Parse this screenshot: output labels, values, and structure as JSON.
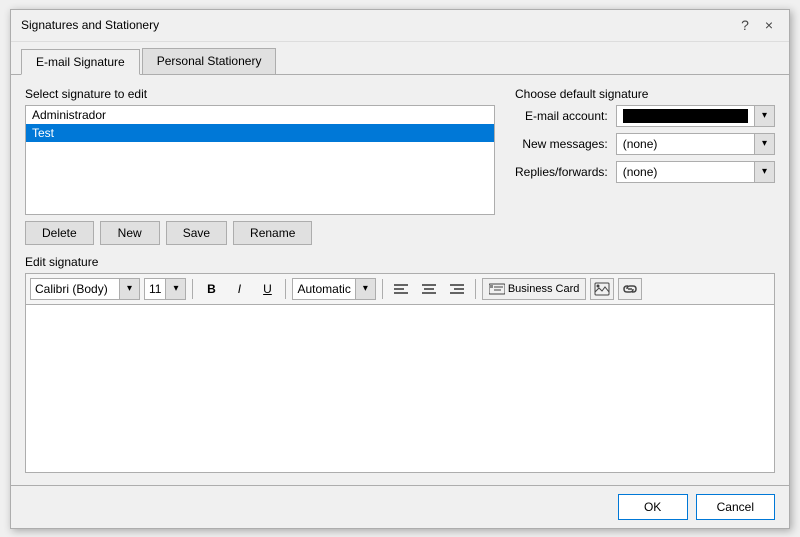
{
  "dialog": {
    "title": "Signatures and Stationery",
    "help_label": "?",
    "close_label": "×"
  },
  "tabs": [
    {
      "label": "E-mail Signature",
      "active": true
    },
    {
      "label": "Personal Stationery",
      "active": false
    }
  ],
  "select_sig": {
    "section_label": "Select signature to edit",
    "items": [
      {
        "text": "Administrador",
        "selected": false
      },
      {
        "text": "Test",
        "selected": true
      }
    ]
  },
  "sig_buttons": {
    "delete": "Delete",
    "new": "New",
    "save": "Save",
    "rename": "Rename"
  },
  "default_sig": {
    "section_label": "Choose default signature",
    "email_label": "E-mail account:",
    "email_value_obscured": true,
    "new_messages_label": "New messages:",
    "new_messages_value": "(none)",
    "replies_label": "Replies/forwards:",
    "replies_value": "(none)"
  },
  "edit_sig": {
    "section_label": "Edit signature",
    "font": "Calibri (Body)",
    "size": "11",
    "bold_label": "B",
    "italic_label": "I",
    "underline_label": "U",
    "color": "Automatic",
    "business_card_label": "Business Card",
    "align_left": "≡",
    "align_center": "≡",
    "align_right": "≡",
    "content": ""
  },
  "footer": {
    "ok_label": "OK",
    "cancel_label": "Cancel"
  }
}
